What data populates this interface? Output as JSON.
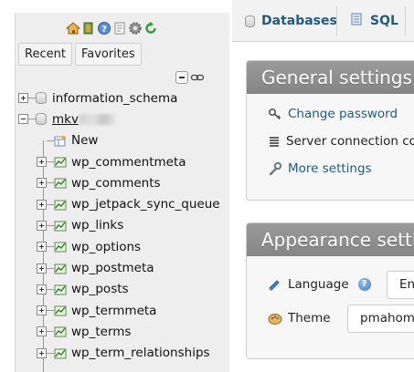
{
  "navigation": {
    "tabs": [
      "Recent",
      "Favorites"
    ],
    "tree": [
      {
        "label": "information_schema",
        "expander": "plus",
        "kind": "db",
        "depth": 0
      },
      {
        "label": "mkv",
        "label_obscured": true,
        "expander": "minus",
        "kind": "db",
        "depth": 0
      },
      {
        "label": "New",
        "expander": "none",
        "kind": "new",
        "depth": 1
      },
      {
        "label": "wp_commentmeta",
        "expander": "plus",
        "kind": "table",
        "depth": 1
      },
      {
        "label": "wp_comments",
        "expander": "plus",
        "kind": "table",
        "depth": 1
      },
      {
        "label": "wp_jetpack_sync_queue",
        "expander": "plus",
        "kind": "table",
        "depth": 1
      },
      {
        "label": "wp_links",
        "expander": "plus",
        "kind": "table",
        "depth": 1
      },
      {
        "label": "wp_options",
        "expander": "plus",
        "kind": "table",
        "depth": 1
      },
      {
        "label": "wp_postmeta",
        "expander": "plus",
        "kind": "table",
        "depth": 1
      },
      {
        "label": "wp_posts",
        "expander": "plus",
        "kind": "table",
        "depth": 1
      },
      {
        "label": "wp_termmeta",
        "expander": "plus",
        "kind": "table",
        "depth": 1
      },
      {
        "label": "wp_terms",
        "expander": "plus",
        "kind": "table",
        "depth": 1
      },
      {
        "label": "wp_term_relationships",
        "expander": "plus",
        "kind": "table",
        "depth": 1
      }
    ],
    "logo_icons": [
      "home-icon",
      "exit-icon",
      "help-icon",
      "docs-icon",
      "gear-icon",
      "reload-icon"
    ],
    "tree_controls": [
      "collapse-all-icon",
      "link-icon"
    ]
  },
  "topbar": {
    "tabs": [
      {
        "label": "Databases",
        "icon": "database-icon"
      },
      {
        "label": "SQL",
        "icon": "sql-icon"
      }
    ]
  },
  "general_settings": {
    "title": "General settings",
    "items": [
      {
        "label": "Change password",
        "icon": "key-icon",
        "is_link": true
      },
      {
        "label": "Server connection collation",
        "icon": "collation-icon",
        "is_link": false
      },
      {
        "label": "More settings",
        "icon": "wrench-icon",
        "is_link": true
      }
    ]
  },
  "appearance_settings": {
    "title": "Appearance settings",
    "language": {
      "label": "Language",
      "value": "English",
      "icon": "language-icon"
    },
    "theme": {
      "label": "Theme",
      "value": "pmahomme",
      "icon": "theme-icon"
    }
  },
  "colors": {
    "link": "#235a81",
    "panel_header": "#8f8f8f",
    "nav_background": "#eeeeee"
  }
}
